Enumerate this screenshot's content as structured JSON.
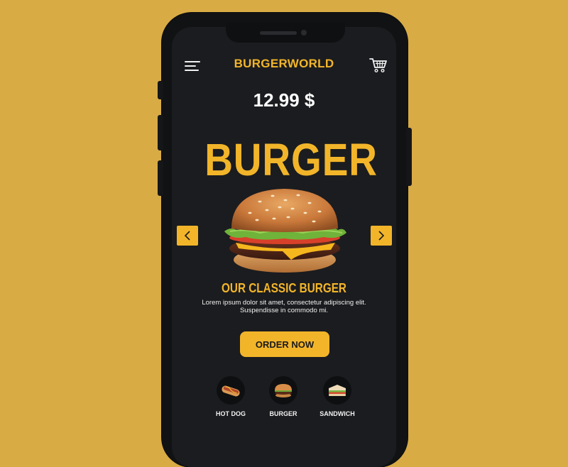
{
  "app": {
    "brand": "BURGERWORLD"
  },
  "product": {
    "price": "12.99 $",
    "title": "BURGER",
    "subtitle": "OUR CLASSIC BURGER",
    "description": "Lorem ipsum dolor sit amet, consectetur adipiscing elit. Suspendisse in commodo mi."
  },
  "actions": {
    "order_label": "ORDER NOW"
  },
  "categories": [
    {
      "label": "HOT DOG",
      "icon": "hotdog-icon"
    },
    {
      "label": "BURGER",
      "icon": "burger-icon"
    },
    {
      "label": "SANDWICH",
      "icon": "sandwich-icon"
    }
  ],
  "colors": {
    "background": "#D8AB45",
    "accent": "#F2B52A",
    "screen": "#1B1C1F"
  },
  "icons": {
    "menu": "hamburger-menu-icon",
    "cart": "cart-icon",
    "prev": "chevron-left-icon",
    "next": "chevron-right-icon"
  }
}
